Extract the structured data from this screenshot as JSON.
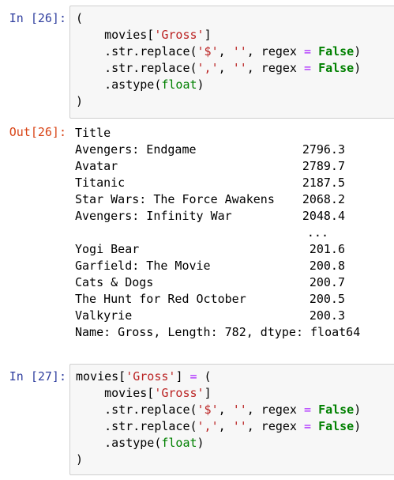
{
  "cells": [
    {
      "in_prompt": "In [26]:",
      "code_lines": [
        [
          {
            "t": "("
          }
        ],
        [
          {
            "t": "    movies["
          },
          {
            "t": "'Gross'",
            "c": "s"
          },
          {
            "t": "]"
          }
        ],
        [
          {
            "t": "    .str.replace("
          },
          {
            "t": "'$'",
            "c": "s"
          },
          {
            "t": ", "
          },
          {
            "t": "''",
            "c": "s"
          },
          {
            "t": ", regex "
          },
          {
            "t": "=",
            "c": "o"
          },
          {
            "t": " "
          },
          {
            "t": "False",
            "c": "k"
          },
          {
            "t": ")"
          }
        ],
        [
          {
            "t": "    .str.replace("
          },
          {
            "t": "','",
            "c": "s"
          },
          {
            "t": ", "
          },
          {
            "t": "''",
            "c": "s"
          },
          {
            "t": ", regex "
          },
          {
            "t": "=",
            "c": "o"
          },
          {
            "t": " "
          },
          {
            "t": "False",
            "c": "k"
          },
          {
            "t": ")"
          }
        ],
        [
          {
            "t": "    .astype("
          },
          {
            "t": "float",
            "c": "b"
          },
          {
            "t": ")"
          }
        ],
        [
          {
            "t": ")"
          }
        ]
      ],
      "out_prompt": "Out[26]:",
      "output": {
        "index_name": "Title",
        "rows": [
          {
            "title": "Avengers: Endgame",
            "value": "2796.3"
          },
          {
            "title": "Avatar",
            "value": "2789.7"
          },
          {
            "title": "Titanic",
            "value": "2187.5"
          },
          {
            "title": "Star Wars: The Force Awakens",
            "value": "2068.2"
          },
          {
            "title": "Avengers: Infinity War",
            "value": "2048.4"
          }
        ],
        "ellipsis": "...",
        "rows_tail": [
          {
            "title": "Yogi Bear",
            "value": "201.6"
          },
          {
            "title": "Garfield: The Movie",
            "value": "200.8"
          },
          {
            "title": "Cats & Dogs",
            "value": "200.7"
          },
          {
            "title": "The Hunt for Red October",
            "value": "200.5"
          },
          {
            "title": "Valkyrie",
            "value": "200.3"
          }
        ],
        "footer": "Name: Gross, Length: 782, dtype: float64"
      }
    },
    {
      "in_prompt": "In [27]:",
      "code_lines": [
        [
          {
            "t": "movies["
          },
          {
            "t": "'Gross'",
            "c": "s"
          },
          {
            "t": "] "
          },
          {
            "t": "=",
            "c": "o"
          },
          {
            "t": " ("
          }
        ],
        [
          {
            "t": "    movies["
          },
          {
            "t": "'Gross'",
            "c": "s"
          },
          {
            "t": "]"
          }
        ],
        [
          {
            "t": "    .str.replace("
          },
          {
            "t": "'$'",
            "c": "s"
          },
          {
            "t": ", "
          },
          {
            "t": "''",
            "c": "s"
          },
          {
            "t": ", regex "
          },
          {
            "t": "=",
            "c": "o"
          },
          {
            "t": " "
          },
          {
            "t": "False",
            "c": "k"
          },
          {
            "t": ")"
          }
        ],
        [
          {
            "t": "    .str.replace("
          },
          {
            "t": "','",
            "c": "s"
          },
          {
            "t": ", "
          },
          {
            "t": "''",
            "c": "s"
          },
          {
            "t": ", regex "
          },
          {
            "t": "=",
            "c": "o"
          },
          {
            "t": " "
          },
          {
            "t": "False",
            "c": "k"
          },
          {
            "t": ")"
          }
        ],
        [
          {
            "t": "    .astype("
          },
          {
            "t": "float",
            "c": "b"
          },
          {
            "t": ")"
          }
        ],
        [
          {
            "t": ")"
          }
        ]
      ]
    }
  ]
}
